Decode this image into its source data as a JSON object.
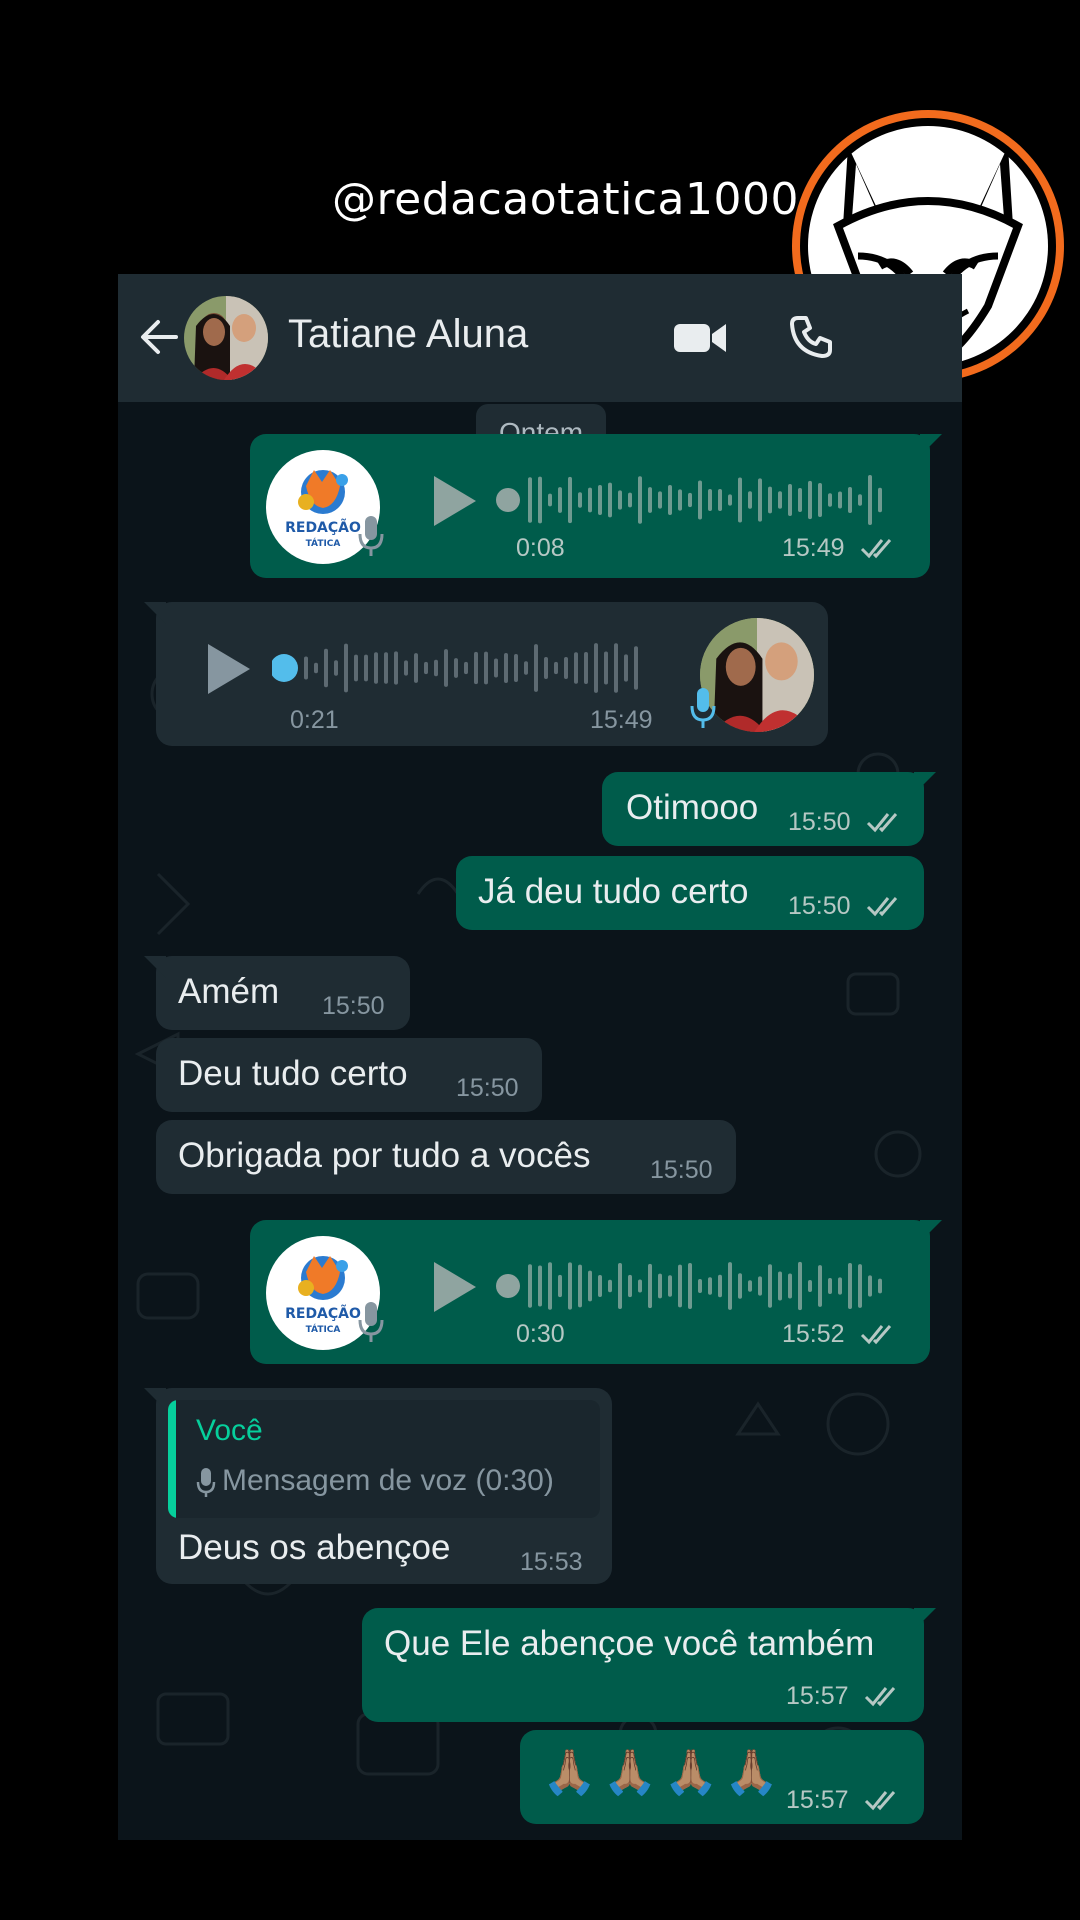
{
  "watermark": {
    "handle": "@redacaotatica1000",
    "badge_icon": "fox-pen-logo"
  },
  "header": {
    "contact_name": "Tatiane Aluna",
    "back_icon": "arrow-left-icon",
    "video_icon": "video-camera-icon",
    "call_icon": "phone-icon"
  },
  "date_chip": "Ontem",
  "brand_logo_text": {
    "line1": "REDAÇÃO",
    "line2": "TÁTICA"
  },
  "messages": [
    {
      "type": "voice",
      "direction": "out",
      "duration": "0:08",
      "time": "15:49",
      "progress": 0
    },
    {
      "type": "voice",
      "direction": "in",
      "duration": "0:21",
      "time": "15:49",
      "progress": 0
    },
    {
      "type": "text",
      "direction": "out",
      "text": "Otimooo",
      "time": "15:50"
    },
    {
      "type": "text",
      "direction": "out",
      "text": "Já deu tudo certo",
      "time": "15:50"
    },
    {
      "type": "text",
      "direction": "in",
      "text": "Amém",
      "time": "15:50"
    },
    {
      "type": "text",
      "direction": "in",
      "text": "Deu tudo certo",
      "time": "15:50"
    },
    {
      "type": "text",
      "direction": "in",
      "text": "Obrigada por tudo a vocês",
      "time": "15:50"
    },
    {
      "type": "voice",
      "direction": "out",
      "duration": "0:30",
      "time": "15:52",
      "progress": 0
    },
    {
      "type": "reply",
      "direction": "in",
      "quote_author": "Você",
      "quote_text": "Mensagem de voz (0:30)",
      "text": "Deus os abençoe",
      "time": "15:53"
    },
    {
      "type": "text",
      "direction": "out",
      "text": "Que Ele abençoe você também",
      "time": "15:57"
    },
    {
      "type": "text",
      "direction": "out",
      "text": "🙏🏽🙏🏽🙏🏽🙏🏽",
      "time": "15:57"
    }
  ],
  "colors": {
    "outgoing_bubble": "#005c4b",
    "incoming_bubble": "#1f2c33",
    "background": "#0b141a",
    "accent": "#06cf9c",
    "read_ticks": "#b6c8c4",
    "logo_ring": "#f26b1d"
  }
}
